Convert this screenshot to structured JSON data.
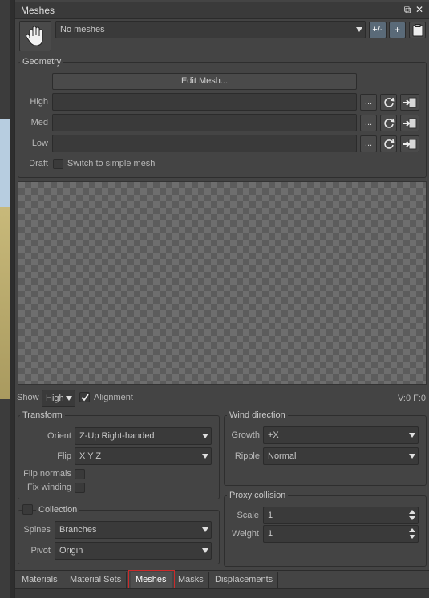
{
  "window": {
    "title": "Meshes",
    "float_glyph": "⧉",
    "close_glyph": "✕"
  },
  "mesh_select": {
    "value": "No meshes",
    "add_remove_label": "+/-",
    "add_label": "+"
  },
  "geometry": {
    "title": "Geometry",
    "edit_mesh_label": "Edit Mesh...",
    "rows": [
      {
        "label": "High",
        "value": "",
        "browse": "..."
      },
      {
        "label": "Med",
        "value": "",
        "browse": "..."
      },
      {
        "label": "Low",
        "value": "",
        "browse": "..."
      }
    ],
    "draft_label": "Draft",
    "draft_option": "Switch to simple mesh"
  },
  "preview_bar": {
    "show_label": "Show",
    "show_value": "High",
    "alignment_label": "Alignment",
    "stats": "V:0 F:0"
  },
  "transform": {
    "title": "Transform",
    "orient_label": "Orient",
    "orient_value": "Z-Up Right-handed",
    "flip_label": "Flip",
    "flip_value": "X Y Z",
    "flip_normals_label": "Flip normals",
    "fix_winding_label": "Fix winding"
  },
  "wind": {
    "title": "Wind direction",
    "growth_label": "Growth",
    "growth_value": "+X",
    "ripple_label": "Ripple",
    "ripple_value": "Normal"
  },
  "collection": {
    "title": "Collection",
    "spines_label": "Spines",
    "spines_value": "Branches",
    "pivot_label": "Pivot",
    "pivot_value": "Origin"
  },
  "proxy": {
    "title": "Proxy collision",
    "scale_label": "Scale",
    "scale_value": "1",
    "weight_label": "Weight",
    "weight_value": "1"
  },
  "tabs": [
    {
      "label": "Materials"
    },
    {
      "label": "Material Sets"
    },
    {
      "label": "Meshes"
    },
    {
      "label": "Masks"
    },
    {
      "label": "Displacements"
    }
  ],
  "icons": [
    "hand-icon",
    "clipboard-icon",
    "refresh-icon",
    "import-icon",
    "check-icon",
    "float-icon",
    "close-icon"
  ],
  "colors": {
    "panel": "#444444",
    "field": "#3a3a3a",
    "accent_button": "#5a6a78",
    "active_tab_outline": "#cc2a2a"
  }
}
